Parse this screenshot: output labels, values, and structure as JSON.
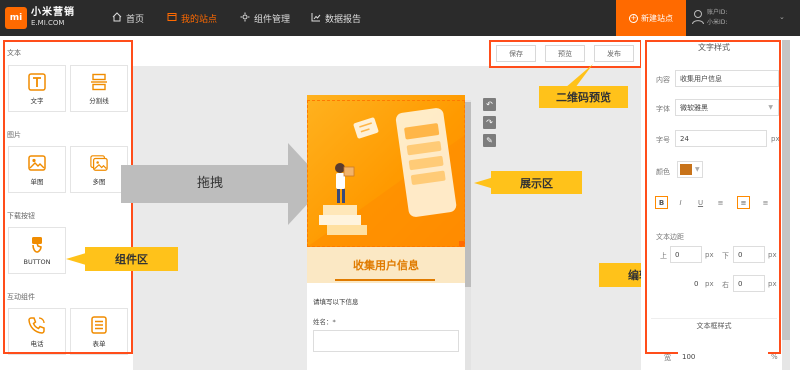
{
  "header": {
    "logo": "mi",
    "brand_name": "小米营销",
    "brand_domain": "E.MI.COM",
    "nav": [
      {
        "label": "首页",
        "icon": "home-icon"
      },
      {
        "label": "我的站点",
        "icon": "site-icon"
      },
      {
        "label": "组件管理",
        "icon": "components-icon"
      },
      {
        "label": "数据报告",
        "icon": "chart-icon"
      }
    ],
    "new_site_label": "新建站点",
    "user_line1": "账户ID:",
    "user_line2": "小米ID:"
  },
  "left_panel": {
    "sections": [
      {
        "title": "文本",
        "items": [
          {
            "label": "文字",
            "icon": "text-icon"
          },
          {
            "label": "分割线",
            "icon": "divider-icon"
          }
        ]
      },
      {
        "title": "图片",
        "items": [
          {
            "label": "单图",
            "icon": "single-image-icon"
          },
          {
            "label": "多图",
            "icon": "multi-image-icon"
          }
        ]
      },
      {
        "title": "下载按钮",
        "items": [
          {
            "label": "BUTTON",
            "icon": "button-icon"
          }
        ]
      },
      {
        "title": "互动组件",
        "items": [
          {
            "label": "电话",
            "icon": "phone-icon"
          },
          {
            "label": "表单",
            "icon": "form-icon"
          }
        ]
      }
    ]
  },
  "toolbar": {
    "save_label": "保存",
    "preview_label": "预览",
    "publish_label": "发布"
  },
  "annotations": {
    "qr_preview": "二维码预览",
    "drag": "拖拽",
    "display_area": "展示区",
    "component_area": "组件区",
    "edit_area": "编辑区"
  },
  "preview": {
    "banner_title": "收集用户信息",
    "form_hint": "请填写以下信息",
    "name_label": "姓名：*"
  },
  "right_panel": {
    "title": "文字样式",
    "content_label": "内容",
    "content_value": "收集用户信息",
    "font_label": "字体",
    "font_value": "微软雅黑",
    "size_label": "字号",
    "size_value": "24",
    "size_unit": "px",
    "color_label": "颜色",
    "color_value": "#c8731a",
    "format_buttons": [
      "B",
      "I",
      "U",
      "left-align",
      "center-align",
      "right-align"
    ],
    "margin_label": "文本边距",
    "margin_top_label": "上",
    "margin_top_value": "0",
    "margin_bottom_label": "下",
    "margin_bottom_value": "0",
    "margin_left_value": "0",
    "margin_right_label": "右",
    "margin_right_value": "0",
    "unit": "px",
    "frame_style_label": "文本框样式",
    "width_label": "宽",
    "width_value": "100",
    "width_unit": "%"
  },
  "colors": {
    "accent": "#ff6a00",
    "highlight_frame": "#ff4d1a",
    "annotation_bg": "#ffc21a",
    "topbar": "#2b2b2b"
  }
}
